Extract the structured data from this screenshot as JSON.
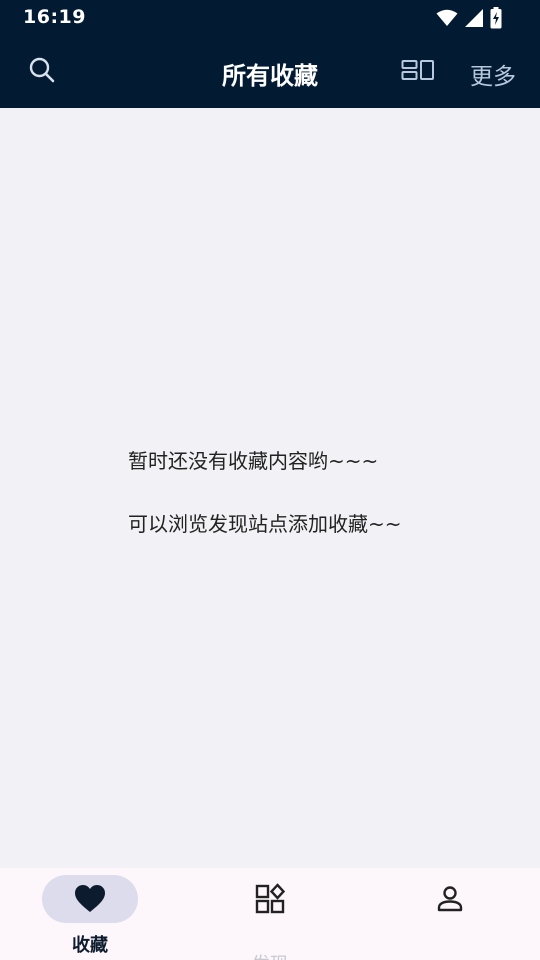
{
  "status_bar": {
    "time": "16:19",
    "icons": [
      "wifi-icon",
      "cellular-signal-icon",
      "battery-charging-icon"
    ]
  },
  "app_bar": {
    "title": "所有收藏",
    "more_label": "更多",
    "icons": [
      "search-icon",
      "layout-toggle-icon"
    ]
  },
  "empty_state": {
    "line1": "暂时还没有收藏内容哟~~~",
    "line2": "可以浏览发现站点添加收藏~~"
  },
  "bottom_nav": {
    "items": [
      {
        "label": "收藏",
        "icon": "heart-icon",
        "active": true
      },
      {
        "label": "发现",
        "icon": "apps-icon",
        "active": false
      },
      {
        "label": "",
        "icon": "person-icon",
        "active": false
      }
    ]
  },
  "colors": {
    "header_bg": "#031a33",
    "content_bg": "#f2f2f6",
    "nav_bg": "#fdf7fc",
    "active_pill": "#dcdcec"
  }
}
